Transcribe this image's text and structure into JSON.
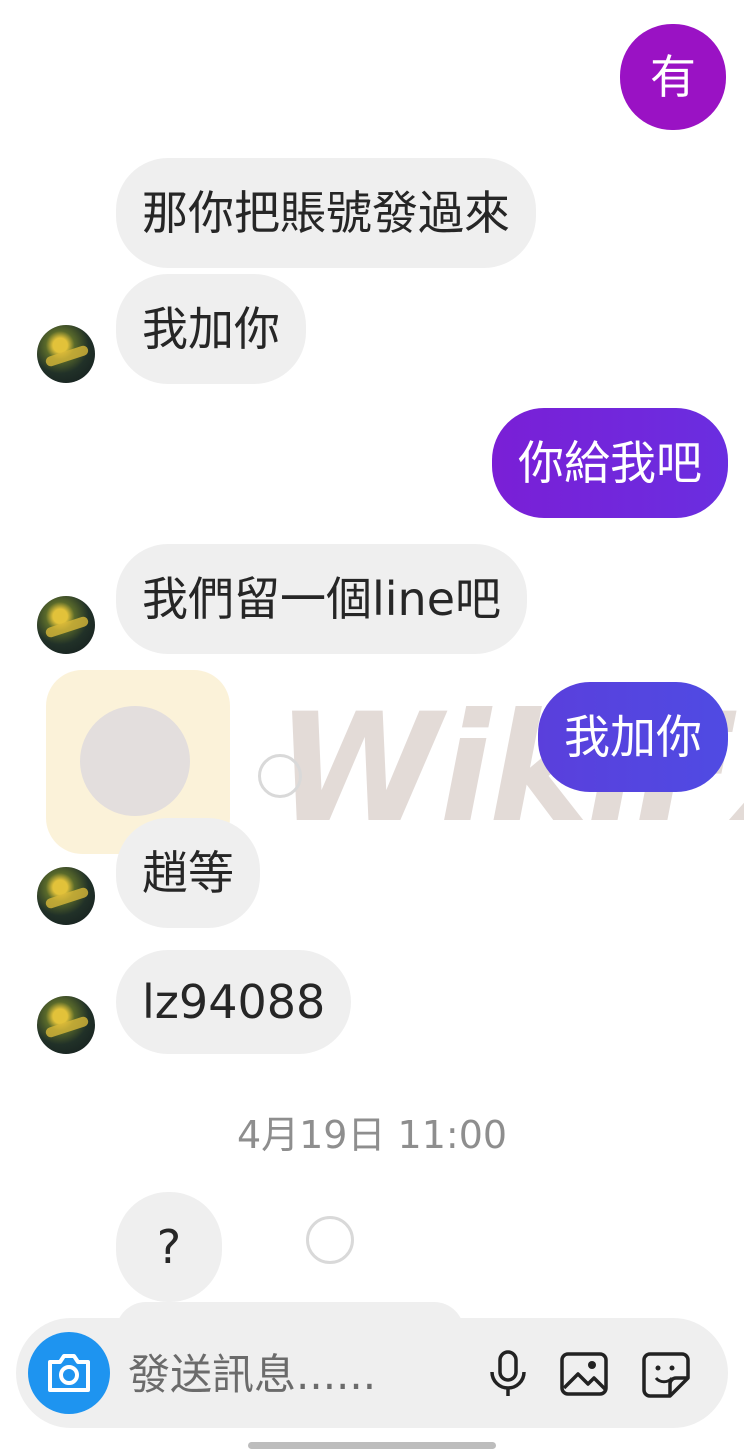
{
  "messages": [
    {
      "side": "out",
      "text": "有"
    },
    {
      "side": "in",
      "text": "那你把賬號發過來"
    },
    {
      "side": "in",
      "text": "我加你"
    },
    {
      "side": "out",
      "text": "你給我吧"
    },
    {
      "side": "in",
      "text": "我們留一個line吧"
    },
    {
      "side": "out",
      "text": "我加你"
    },
    {
      "side": "in",
      "text": "趙等"
    },
    {
      "side": "in",
      "text": "lz94088"
    },
    {
      "side": "in",
      "text": "?"
    }
  ],
  "timestamp": "4月19日 11:00",
  "watermark": {
    "text": "WikiFX"
  },
  "composer": {
    "placeholder": "發送訊息......",
    "icons": [
      "camera-icon",
      "microphone-icon",
      "gallery-icon",
      "sticker-icon"
    ]
  },
  "colors": {
    "incoming_bg": "#efefef",
    "out_1": "#9a12c4",
    "out_2_from": "#7a1fd6",
    "out_2_to": "#6a2ee0",
    "out_3_from": "#5a3fdc",
    "out_3_to": "#4f4be3",
    "camera": "#1e94f0"
  }
}
